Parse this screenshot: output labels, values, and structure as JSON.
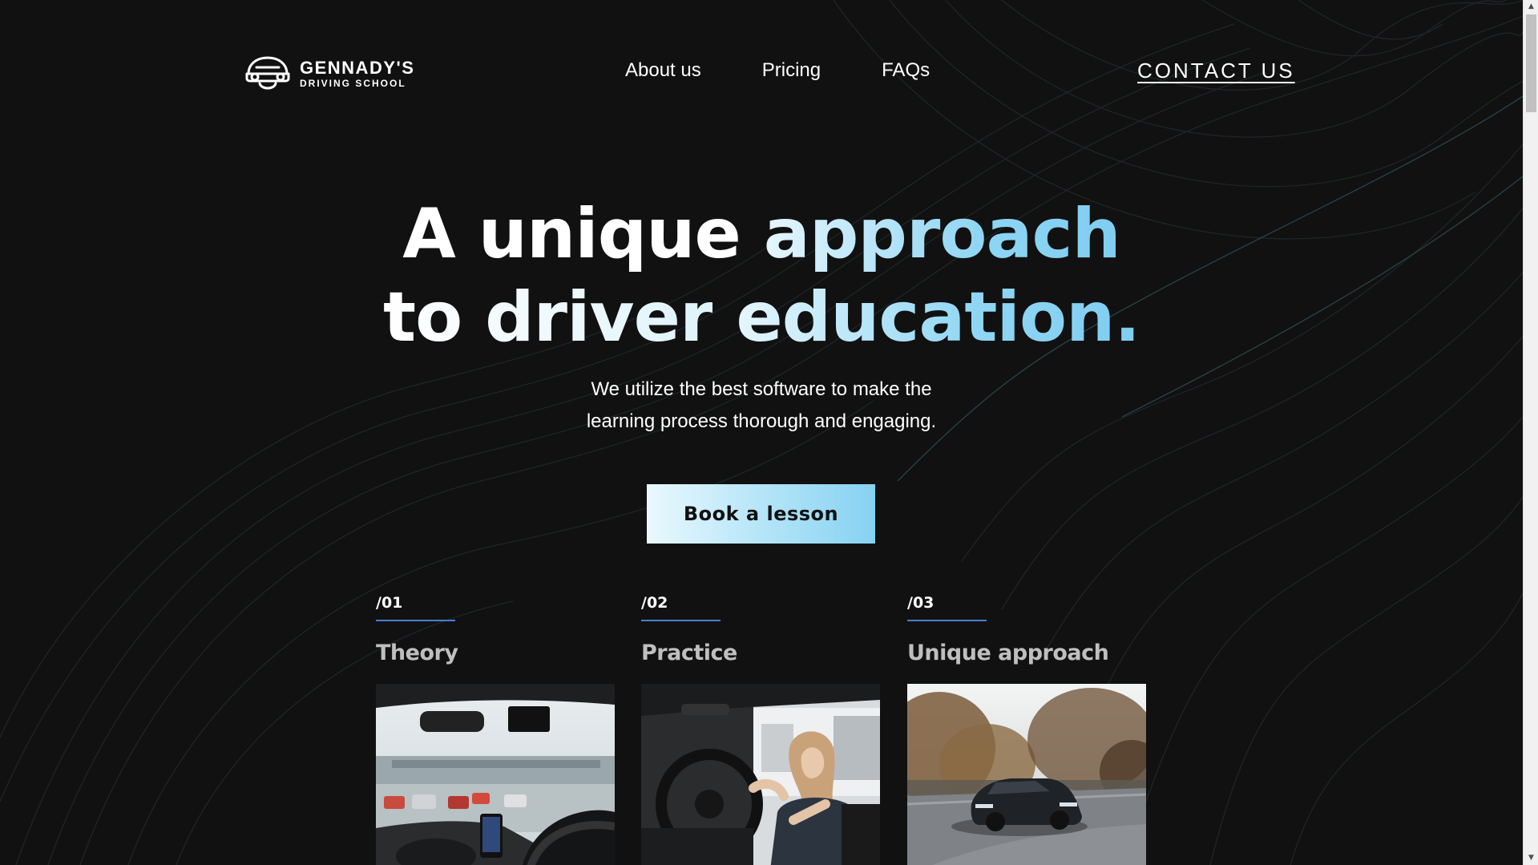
{
  "header": {
    "logo_name": "GENNADY'S",
    "logo_sub": "DRIVING SCHOOL",
    "logo_icon": "car-face-icon",
    "nav": [
      {
        "label": "About us"
      },
      {
        "label": "Pricing"
      },
      {
        "label": "FAQs"
      }
    ],
    "contact_label": "CONTACT US"
  },
  "hero": {
    "line1_white": "A unique",
    "line1_accent": "approach",
    "line2_white": "to driver",
    "line2_accent": "education.",
    "subtitle_line1": "We utilize the best software to make the",
    "subtitle_line2": "learning process thorough and engaging.",
    "cta_label": "Book a lesson"
  },
  "features": [
    {
      "number": "/01",
      "title": "Theory",
      "image": "car-dashboard-traffic-photo"
    },
    {
      "number": "/02",
      "title": "Practice",
      "image": "woman-driving-car-photo"
    },
    {
      "number": "/03",
      "title": "Unique approach",
      "image": "dark-car-on-road-photo"
    }
  ],
  "colors": {
    "background": "#111111",
    "accent": "#86d2f2",
    "rule": "#4a7fd0",
    "text": "#ffffff",
    "muted_title": "#bfbfbf"
  }
}
